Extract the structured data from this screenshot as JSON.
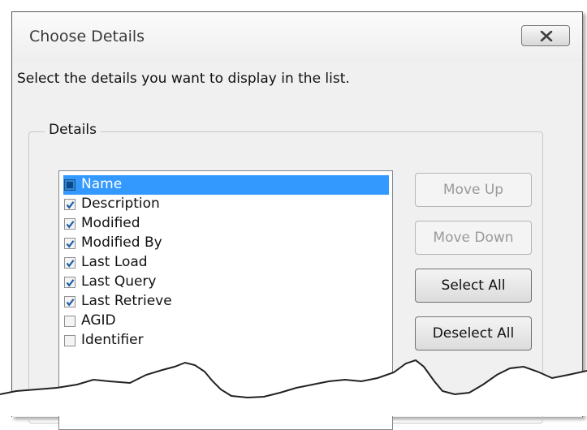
{
  "window": {
    "title": "Choose Details"
  },
  "instruction": "Select the details you want to display in the list.",
  "group_label": "Details",
  "items": [
    {
      "label": "Name",
      "checked": true,
      "selected": true
    },
    {
      "label": "Description",
      "checked": true,
      "selected": false
    },
    {
      "label": "Modified",
      "checked": true,
      "selected": false
    },
    {
      "label": "Modified By",
      "checked": true,
      "selected": false
    },
    {
      "label": "Last Load",
      "checked": true,
      "selected": false
    },
    {
      "label": "Last Query",
      "checked": true,
      "selected": false
    },
    {
      "label": "Last Retrieve",
      "checked": true,
      "selected": false
    },
    {
      "label": "AGID",
      "checked": false,
      "selected": false
    },
    {
      "label": "Identifier",
      "checked": false,
      "selected": false
    }
  ],
  "buttons": {
    "move_up": "Move Up",
    "move_down": "Move Down",
    "select_all": "Select All",
    "deselect_all": "Deselect All"
  },
  "colors": {
    "selection": "#3399ff",
    "dialog_bg": "#f0f0f0",
    "check": "#1f5fa8"
  }
}
